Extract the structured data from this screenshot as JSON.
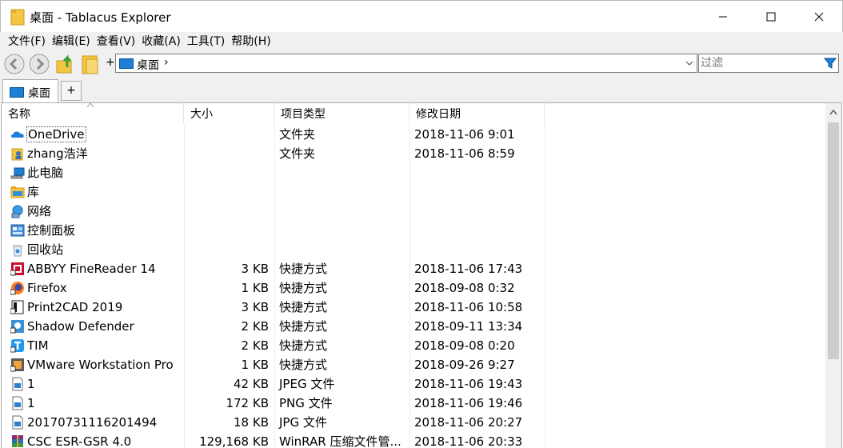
{
  "window": {
    "title": "桌面 - Tablacus Explorer"
  },
  "menu": [
    "文件(F)",
    "编辑(E)",
    "查看(V)",
    "收藏(A)",
    "工具(T)",
    "帮助(H)"
  ],
  "toolbar": {
    "plus_label": "+",
    "address_text": "桌面",
    "address_separator": "›",
    "filter_placeholder": "过滤"
  },
  "tabs": [
    {
      "label": "桌面",
      "active": true
    }
  ],
  "new_tab_label": "+",
  "columns": {
    "name": "名称",
    "size": "大小",
    "type": "项目类型",
    "date": "修改日期"
  },
  "files": [
    {
      "name": "OneDrive",
      "size": "",
      "type": "文件夹",
      "date": "2018-11-06 9:01",
      "icon": "onedrive-icon",
      "focused": true
    },
    {
      "name": "zhang浩洋",
      "size": "",
      "type": "文件夹",
      "date": "2018-11-06 8:59",
      "icon": "user-folder-icon"
    },
    {
      "name": "此电脑",
      "size": "",
      "type": "",
      "date": "",
      "icon": "computer-icon"
    },
    {
      "name": "库",
      "size": "",
      "type": "",
      "date": "",
      "icon": "library-icon"
    },
    {
      "name": "网络",
      "size": "",
      "type": "",
      "date": "",
      "icon": "network-icon"
    },
    {
      "name": "控制面板",
      "size": "",
      "type": "",
      "date": "",
      "icon": "control-panel-icon"
    },
    {
      "name": "回收站",
      "size": "",
      "type": "",
      "date": "",
      "icon": "recycle-bin-icon"
    },
    {
      "name": "ABBYY FineReader 14",
      "size": "3 KB",
      "type": "快捷方式",
      "date": "2018-11-06 17:43",
      "icon": "abbyy-icon"
    },
    {
      "name": "Firefox",
      "size": "1 KB",
      "type": "快捷方式",
      "date": "2018-09-08 0:32",
      "icon": "firefox-icon"
    },
    {
      "name": "Print2CAD 2019",
      "size": "3 KB",
      "type": "快捷方式",
      "date": "2018-11-06 10:58",
      "icon": "print2cad-icon"
    },
    {
      "name": "Shadow Defender",
      "size": "2 KB",
      "type": "快捷方式",
      "date": "2018-09-11 13:34",
      "icon": "shadow-defender-icon"
    },
    {
      "name": "TIM",
      "size": "2 KB",
      "type": "快捷方式",
      "date": "2018-09-08 0:20",
      "icon": "tim-icon"
    },
    {
      "name": "VMware Workstation Pro",
      "size": "1 KB",
      "type": "快捷方式",
      "date": "2018-09-26 9:27",
      "icon": "vmware-icon"
    },
    {
      "name": "1",
      "size": "42 KB",
      "type": "JPEG 文件",
      "date": "2018-11-06 19:43",
      "icon": "image-file-icon"
    },
    {
      "name": "1",
      "size": "172 KB",
      "type": "PNG 文件",
      "date": "2018-11-06 19:46",
      "icon": "image-file-icon"
    },
    {
      "name": "20170731116201494",
      "size": "18 KB",
      "type": "JPG 文件",
      "date": "2018-11-06 20:27",
      "icon": "image-file-icon"
    },
    {
      "name": "CSC ESR-GSR 4.0",
      "size": "129,168 KB",
      "type": "WinRAR 压缩文件管...",
      "date": "2018-11-06 20:33",
      "icon": "winrar-icon"
    }
  ],
  "colors": {
    "chrome_bg": "#f0f0f0",
    "accent_blue": "#1e7fd6",
    "folder_yellow": "#f4c542"
  }
}
